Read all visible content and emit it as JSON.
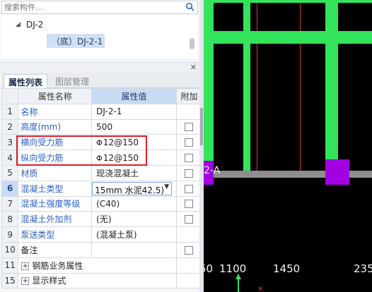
{
  "search": {
    "placeholder": "搜索构件..."
  },
  "tree": {
    "parent_label": "DJ-2",
    "child_label": "（底）DJ-2-1"
  },
  "tabs": [
    {
      "label": "属性列表"
    },
    {
      "label": "图层管理"
    }
  ],
  "grid": {
    "headers": {
      "name": "属性名称",
      "value": "属性值",
      "extra": "附加"
    },
    "rows": [
      {
        "num": "1",
        "name": "名称",
        "value": "DJ-2-1"
      },
      {
        "num": "2",
        "name": "高度(mm)",
        "value": "500"
      },
      {
        "num": "3",
        "name": "横向受力筋",
        "value_symbol": "Φ",
        "value": "12@150"
      },
      {
        "num": "4",
        "name": "纵向受力筋",
        "value_symbol": "Φ",
        "value": "12@150"
      },
      {
        "num": "5",
        "name": "材质",
        "value": "现浇混凝土"
      },
      {
        "num": "6",
        "name": "混凝土类型",
        "value": "15mm 水泥42.5)"
      },
      {
        "num": "7",
        "name": "混凝土强度等级",
        "value": "(C40)"
      },
      {
        "num": "8",
        "name": "混凝土外加剂",
        "value": "(无)"
      },
      {
        "num": "9",
        "name": "泵送类型",
        "value": "(混凝土泵)"
      },
      {
        "num": "10",
        "name": "备注",
        "value": ""
      },
      {
        "num": "11",
        "name": "钢筋业务属性",
        "value": ""
      },
      {
        "num": "15",
        "name": "显示样式",
        "value": ""
      }
    ]
  },
  "viewport": {
    "axis_label": "2-A",
    "dimensions": [
      "50",
      "1100",
      "1450",
      "235"
    ],
    "colors": {
      "beam": "#33e35a",
      "column": "#a100e0",
      "gridline": "#d8383e",
      "background": "#000000"
    }
  },
  "colors": {
    "accent": "#2b5fc7",
    "highlight": "#e11d24",
    "selection": "#cfe0f6"
  }
}
